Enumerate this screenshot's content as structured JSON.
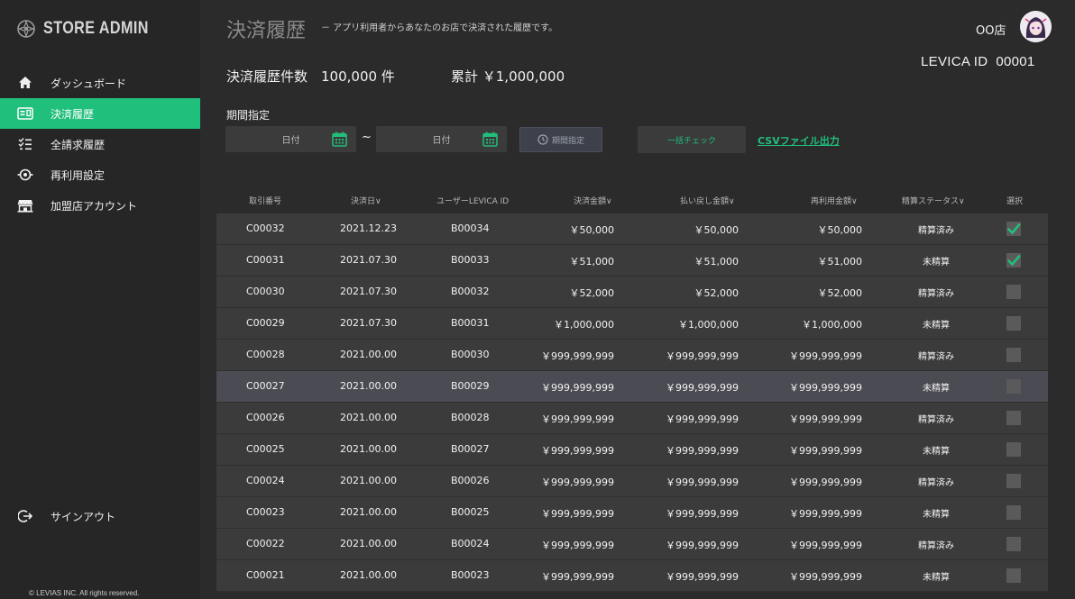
{
  "brand": {
    "name": "STORE ADMIN"
  },
  "sidebar": {
    "items": [
      {
        "label": "ダッシュボード",
        "icon": "home-icon"
      },
      {
        "label": "決済履歴",
        "icon": "card-icon",
        "active": true
      },
      {
        "label": "全請求履歴",
        "icon": "list-icon"
      },
      {
        "label": "再利用設定",
        "icon": "target-icon"
      },
      {
        "label": "加盟店アカウント",
        "icon": "store-icon"
      }
    ],
    "signout": "サインアウト",
    "copyright": "© LEVIAS INC. All rights reserved."
  },
  "header": {
    "title": "決済履歴",
    "subtitle": "－ アプリ利用者からあなたのお店で決済された履歴です。",
    "store_name": "OO店",
    "levica_id": "LEVICA ID  00001"
  },
  "summary": {
    "count_text": "決済履歴件数　100,000 件",
    "total_text": "累計 ￥1,000,000"
  },
  "filters": {
    "period_label": "期間指定",
    "date_from_placeholder": "日付",
    "date_to_placeholder": "日付",
    "separator": "~",
    "period_button": "期間指定",
    "bulk_check_button": "一括チェック",
    "csv_link": "CSVファイル出力"
  },
  "colors": {
    "accent": "#20bf7c",
    "background": "#2b2b2b",
    "row": "#3b3b3b"
  },
  "table": {
    "headers": [
      "取引番号",
      "決済日",
      "ユーザーLEVICA ID",
      "決済金額",
      "払い戻し金額",
      "再利用金額",
      "精算ステータス",
      "選択"
    ],
    "rows": [
      {
        "id": "C00032",
        "date": "2021.12.23",
        "user": "B00034",
        "amount": "￥50,000",
        "refund": "￥50,000",
        "reuse": "￥50,000",
        "status": "精算済み",
        "checked": true
      },
      {
        "id": "C00031",
        "date": "2021.07.30",
        "user": "B00033",
        "amount": "￥51,000",
        "refund": "￥51,000",
        "reuse": "￥51,000",
        "status": "未精算",
        "checked": true
      },
      {
        "id": "C00030",
        "date": "2021.07.30",
        "user": "B00032",
        "amount": "￥52,000",
        "refund": "￥52,000",
        "reuse": "￥52,000",
        "status": "精算済み",
        "checked": false
      },
      {
        "id": "C00029",
        "date": "2021.07.30",
        "user": "B00031",
        "amount": "￥1,000,000",
        "refund": "￥1,000,000",
        "reuse": "￥1,000,000",
        "status": "未精算",
        "checked": false
      },
      {
        "id": "C00028",
        "date": "2021.00.00",
        "user": "B00030",
        "amount": "￥999,999,999",
        "refund": "￥999,999,999",
        "reuse": "￥999,999,999",
        "status": "精算済み",
        "checked": false
      },
      {
        "id": "C00027",
        "date": "2021.00.00",
        "user": "B00029",
        "amount": "￥999,999,999",
        "refund": "￥999,999,999",
        "reuse": "￥999,999,999",
        "status": "未精算",
        "checked": false,
        "highlight": true
      },
      {
        "id": "C00026",
        "date": "2021.00.00",
        "user": "B00028",
        "amount": "￥999,999,999",
        "refund": "￥999,999,999",
        "reuse": "￥999,999,999",
        "status": "精算済み",
        "checked": false
      },
      {
        "id": "C00025",
        "date": "2021.00.00",
        "user": "B00027",
        "amount": "￥999,999,999",
        "refund": "￥999,999,999",
        "reuse": "￥999,999,999",
        "status": "未精算",
        "checked": false
      },
      {
        "id": "C00024",
        "date": "2021.00.00",
        "user": "B00026",
        "amount": "￥999,999,999",
        "refund": "￥999,999,999",
        "reuse": "￥999,999,999",
        "status": "精算済み",
        "checked": false
      },
      {
        "id": "C00023",
        "date": "2021.00.00",
        "user": "B00025",
        "amount": "￥999,999,999",
        "refund": "￥999,999,999",
        "reuse": "￥999,999,999",
        "status": "未精算",
        "checked": false
      },
      {
        "id": "C00022",
        "date": "2021.00.00",
        "user": "B00024",
        "amount": "￥999,999,999",
        "refund": "￥999,999,999",
        "reuse": "￥999,999,999",
        "status": "精算済み",
        "checked": false
      },
      {
        "id": "C00021",
        "date": "2021.00.00",
        "user": "B00023",
        "amount": "￥999,999,999",
        "refund": "￥999,999,999",
        "reuse": "￥999,999,999",
        "status": "未精算",
        "checked": false
      }
    ]
  }
}
